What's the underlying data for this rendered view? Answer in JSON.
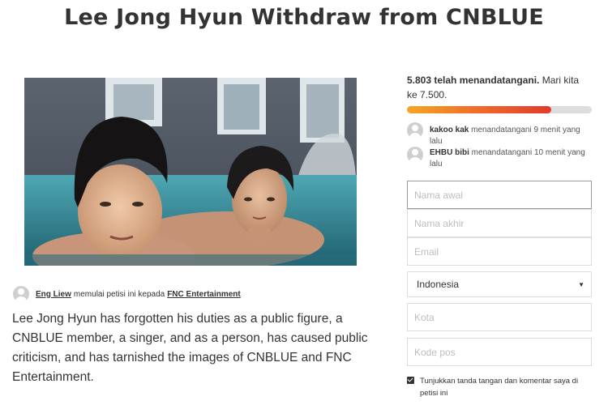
{
  "page": {
    "title": "Lee Jong Hyun Withdraw from CNBLUE"
  },
  "petition": {
    "starter_name": "Eng Liew",
    "starter_text": "memulai petisi ini kepada",
    "target": "FNC Entertainment",
    "description": "Lee Jong Hyun has forgotten his duties as a public figure, a CNBLUE member, a singer, and as a person, has caused public criticism, and has tarnished the images of CNBLUE and FNC Entertainment."
  },
  "signatures": {
    "count_text": "5.803 telah menandatangani.",
    "goal_text": "Mari kita ke 7.500.",
    "progress_fraction": 0.78,
    "recent": [
      {
        "name": "kakoo kak",
        "text": "menandatangani 9 menit yang lalu"
      },
      {
        "name": "EHBU bibi",
        "text": "menandatangani 10 menit yang lalu"
      }
    ]
  },
  "form": {
    "first_name_placeholder": "Nama awal",
    "last_name_placeholder": "Nama akhir",
    "email_placeholder": "Email",
    "country_value": "Indonesia",
    "city_placeholder": "Kota",
    "postal_placeholder": "Kode pos",
    "show_signature_label": "Tunjukkan tanda tangan dan komentar saya di petisi ini",
    "show_signature_checked": true
  },
  "colors": {
    "progress_start": "#f5a623",
    "progress_end": "#e03b2c",
    "text": "#333333"
  },
  "icons": {
    "avatar": "user-avatar-icon",
    "select_caret": "caret-down-icon",
    "checkbox": "checkbox-checked-icon"
  }
}
